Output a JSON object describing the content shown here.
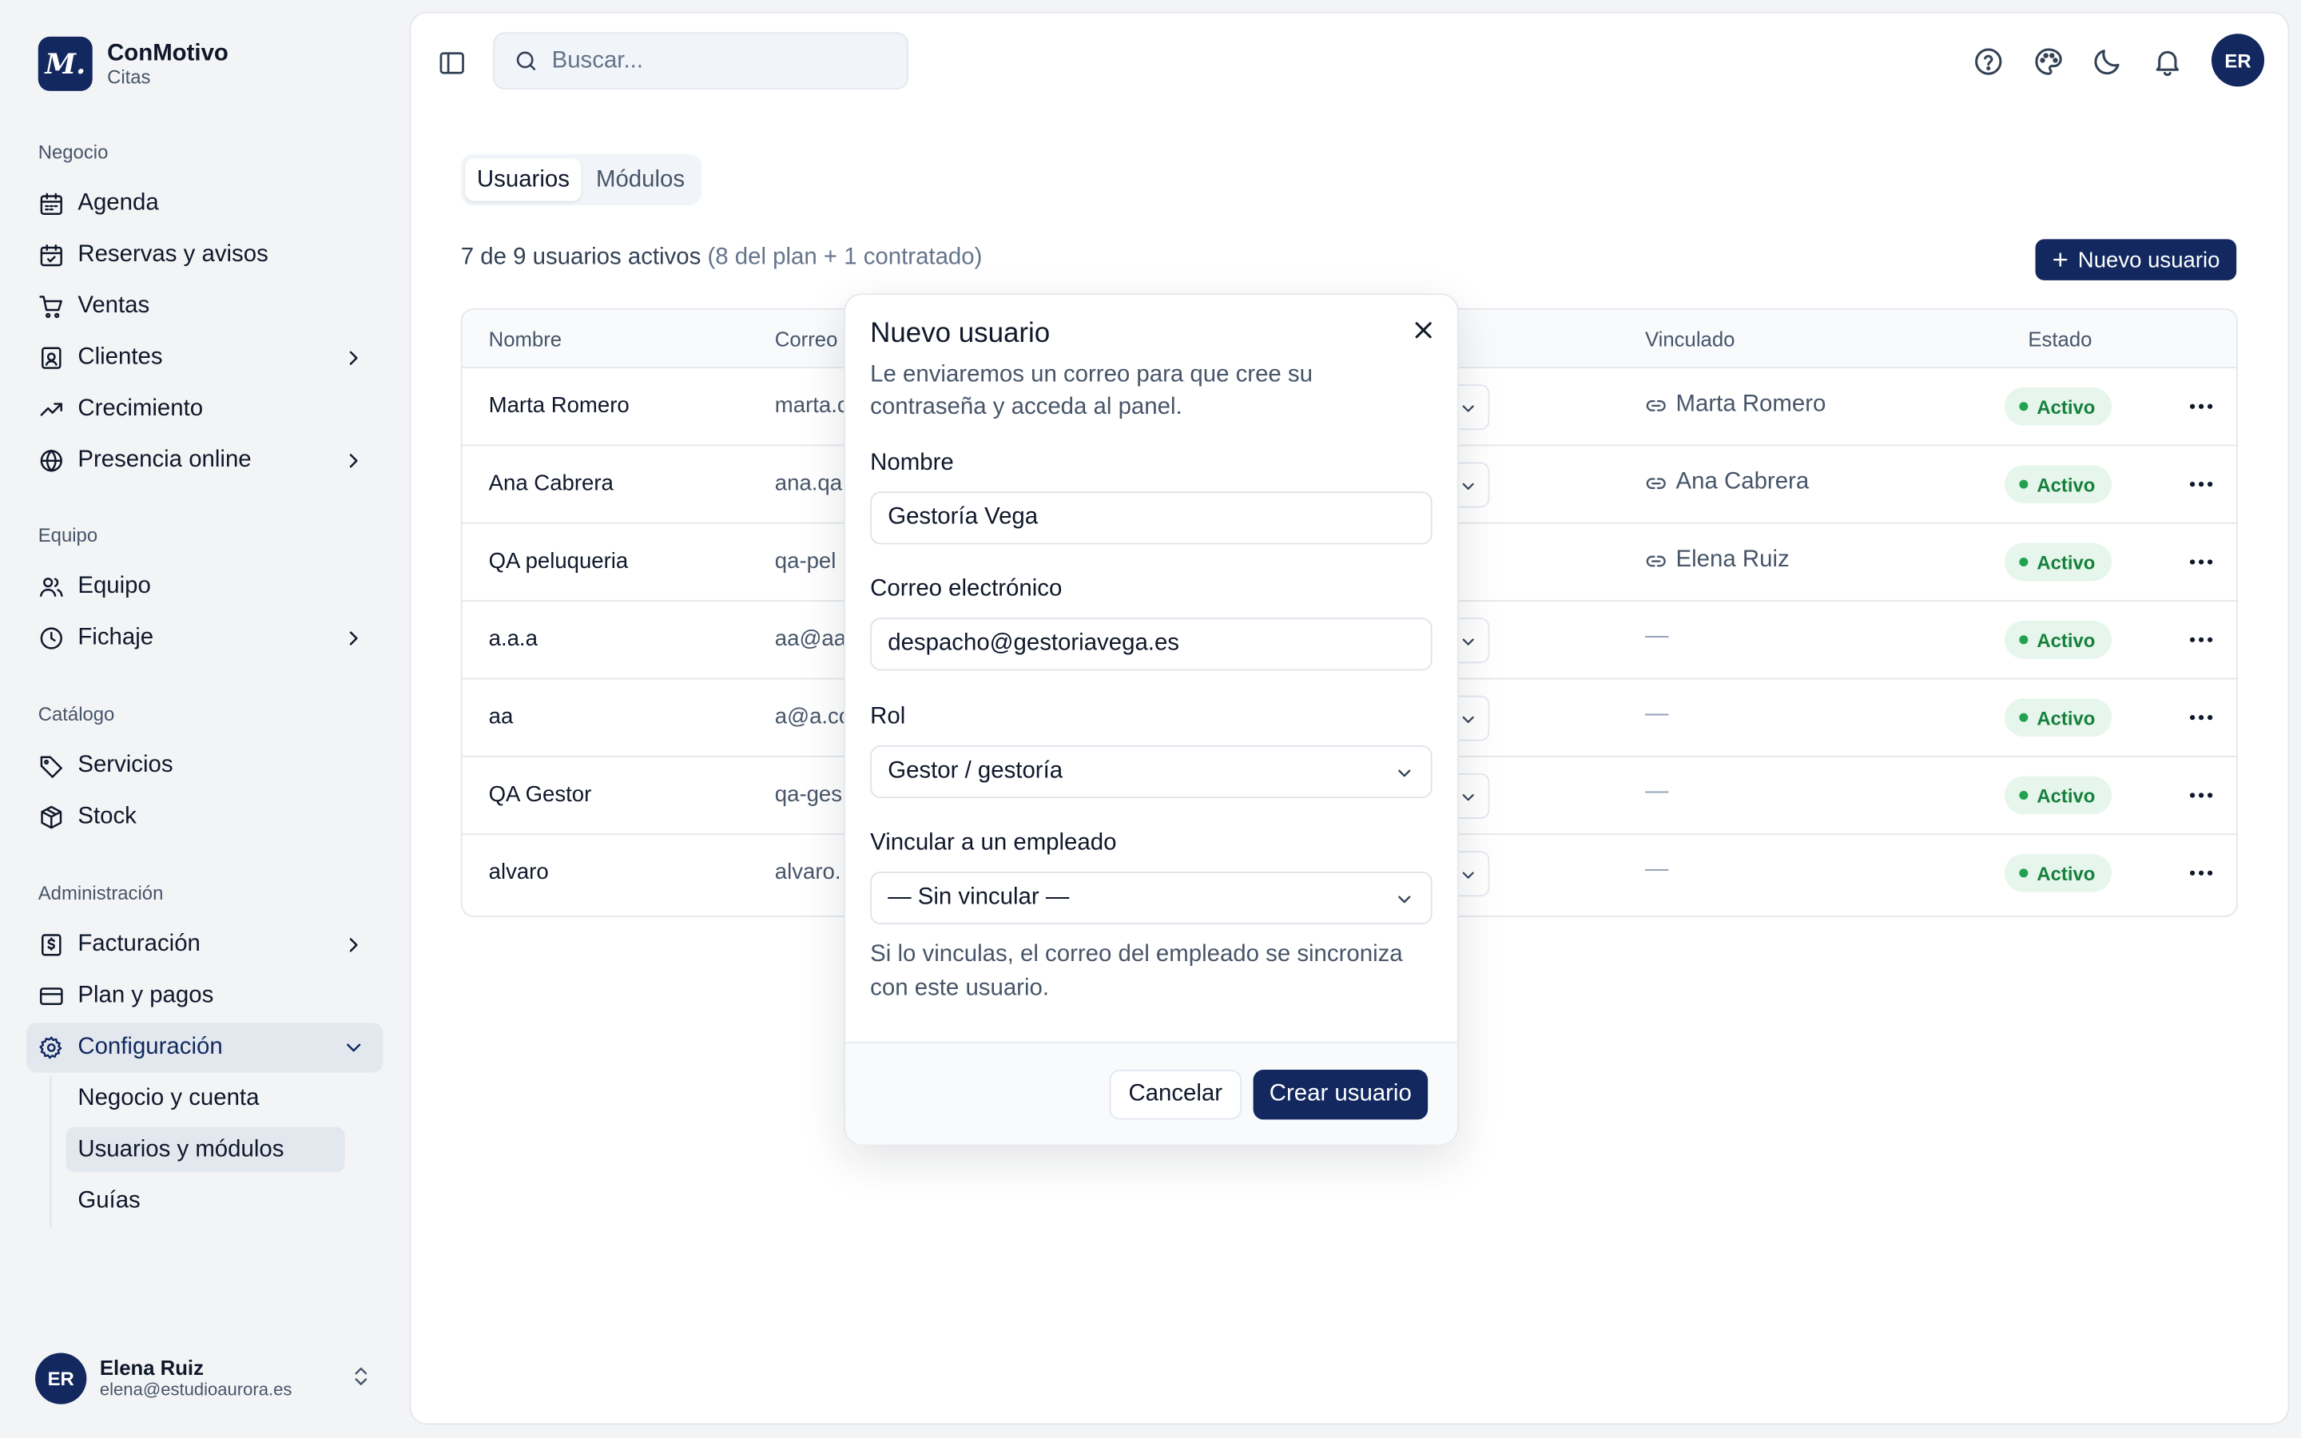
{
  "brand": {
    "name": "ConMotivo",
    "sub": "Citas",
    "logo_letter": "M."
  },
  "sidebar": {
    "groups": {
      "negocio": "Negocio",
      "equipo": "Equipo",
      "catalogo": "Catálogo",
      "administracion": "Administración"
    },
    "items": {
      "agenda": "Agenda",
      "reservas": "Reservas y avisos",
      "ventas": "Ventas",
      "clientes": "Clientes",
      "crecimiento": "Crecimiento",
      "presencia": "Presencia online",
      "equipo": "Equipo",
      "fichaje": "Fichaje",
      "servicios": "Servicios",
      "stock": "Stock",
      "facturacion": "Facturación",
      "plan": "Plan y pagos",
      "configuracion": "Configuración"
    },
    "sub_items": {
      "negocio_cuenta": "Negocio y cuenta",
      "usuarios_modulos": "Usuarios y módulos",
      "guias": "Guías"
    },
    "user": {
      "initials": "ER",
      "name": "Elena Ruiz",
      "email": "elena@estudioaurora.es"
    }
  },
  "header": {
    "search_placeholder": "Buscar...",
    "avatar_initials": "ER"
  },
  "tabs": {
    "usuarios": "Usuarios",
    "modulos": "Módulos"
  },
  "summary": {
    "main": "7 de 9 usuarios activos",
    "detail": "(8 del plan + 1 contratado)"
  },
  "new_user_button": "Nuevo usuario",
  "table": {
    "headers": {
      "nombre": "Nombre",
      "correo": "Correo",
      "vinculado": "Vinculado",
      "estado": "Estado"
    },
    "rows": [
      {
        "name": "Marta Romero",
        "email": "marta.c",
        "linked": "Marta Romero",
        "status": "Activo"
      },
      {
        "name": "Ana Cabrera",
        "email": "ana.qa",
        "linked": "Ana Cabrera",
        "status": "Activo"
      },
      {
        "name": "QA peluqueria",
        "email": "qa-pel",
        "linked": "Elena Ruiz",
        "status": "Activo"
      },
      {
        "name": "a.a.a",
        "email": "aa@aa",
        "linked": "—",
        "status": "Activo"
      },
      {
        "name": "aa",
        "email": "a@a.co",
        "linked": "—",
        "status": "Activo"
      },
      {
        "name": "QA Gestor",
        "email": "qa-ges",
        "linked": "—",
        "status": "Activo"
      },
      {
        "name": "alvaro",
        "email": "alvaro.",
        "linked": "—",
        "status": "Activo"
      }
    ]
  },
  "modal": {
    "title": "Nuevo usuario",
    "description": "Le enviaremos un correo para que cree su contraseña y acceda al panel.",
    "name_label": "Nombre",
    "name_value": "Gestoría Vega",
    "email_label": "Correo electrónico",
    "email_value": "despacho@gestoriavega.es",
    "role_label": "Rol",
    "role_value": "Gestor / gestoría",
    "link_label": "Vincular a un empleado",
    "link_value": "— Sin vincular —",
    "help": "Si lo vinculas, el correo del empleado se sincroniza con este usuario.",
    "cancel": "Cancelar",
    "create": "Crear usuario"
  },
  "colors": {
    "brand": "#12285f",
    "active_badge_bg": "#e6f6ec",
    "active_badge_text": "#16803c",
    "background": "#f3f4f6"
  }
}
